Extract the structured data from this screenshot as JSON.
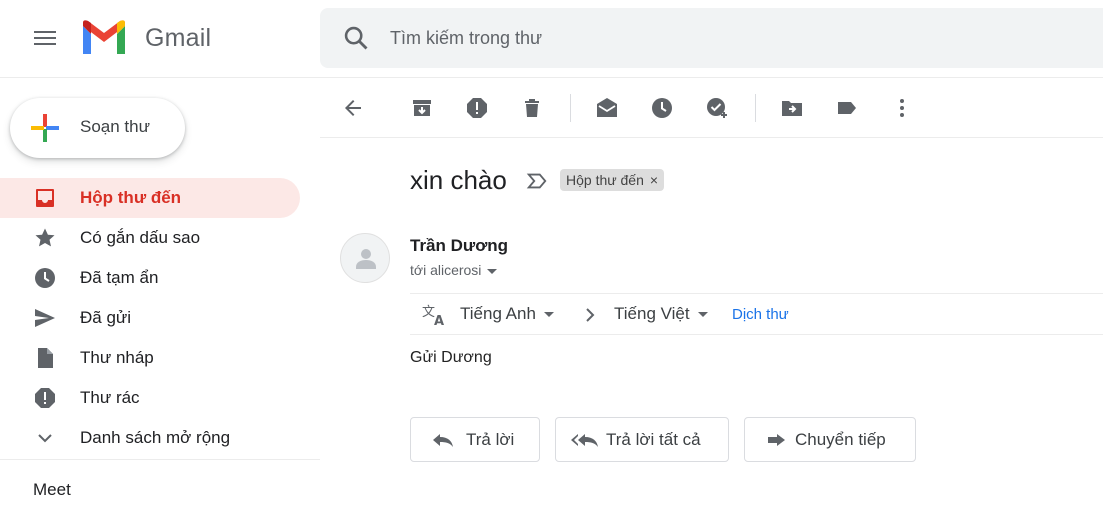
{
  "header": {
    "brand": "Gmail",
    "search_placeholder": "Tìm kiếm trong thư"
  },
  "sidebar": {
    "compose_label": "Soạn thư",
    "items": [
      {
        "label": "Hộp thư đến",
        "icon": "inbox-icon",
        "active": true
      },
      {
        "label": "Có gắn dấu sao",
        "icon": "star-icon"
      },
      {
        "label": "Đã tạm ẩn",
        "icon": "clock-icon"
      },
      {
        "label": "Đã gửi",
        "icon": "send-icon"
      },
      {
        "label": "Thư nháp",
        "icon": "draft-icon"
      },
      {
        "label": "Thư rác",
        "icon": "spam-icon"
      },
      {
        "label": "Danh sách mở rộng",
        "icon": "chevron-down-icon"
      }
    ],
    "meet_label": "Meet"
  },
  "toolbar": {
    "icons": [
      "back-arrow-icon",
      "archive-icon",
      "report-spam-icon",
      "delete-icon",
      "mark-unread-icon",
      "snooze-icon",
      "add-task-icon",
      "move-to-icon",
      "label-icon",
      "more-vert-icon"
    ]
  },
  "message": {
    "subject": "xin chào",
    "label_chip": "Hộp thư đến",
    "label_chip_close": "×",
    "sender": "Trần Dương",
    "recipient": "tới alicerosi",
    "body": "Gửi Dương"
  },
  "translate": {
    "from": "Tiếng Anh",
    "to": "Tiếng Việt",
    "link": "Dịch thư"
  },
  "actions": {
    "reply": "Trả lời",
    "reply_all": "Trả lời tất cả",
    "forward": "Chuyển tiếp"
  },
  "colors": {
    "active_red": "#d93025",
    "active_bg": "#fce8e6",
    "link_blue": "#1a73e8",
    "icon_gray": "#5f6368"
  }
}
